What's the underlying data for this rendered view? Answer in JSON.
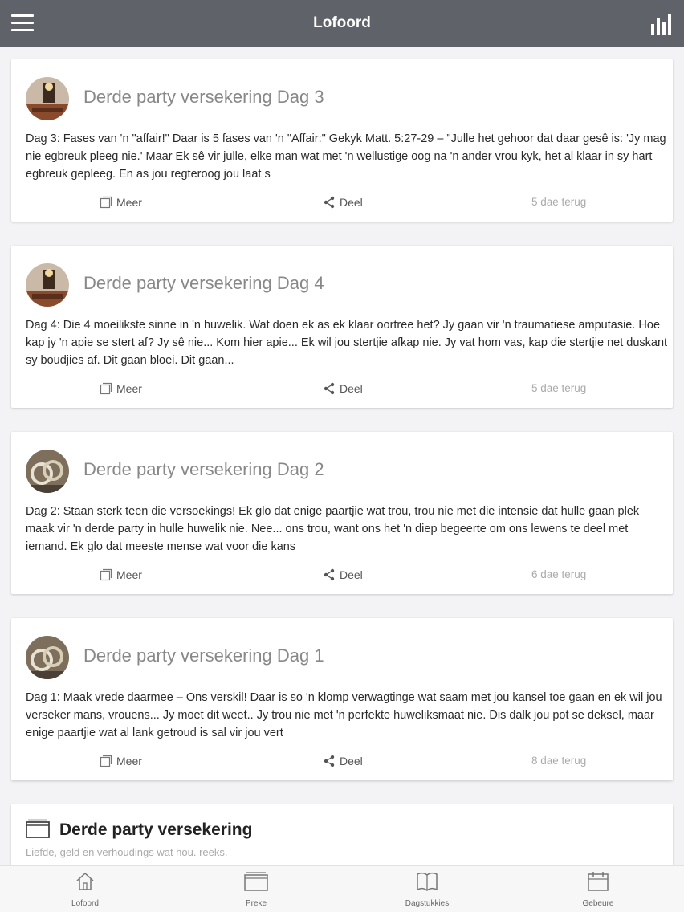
{
  "app": {
    "title": "Lofoord"
  },
  "header": {
    "menu_icon": "hamburger-menu-icon",
    "stats_icon": "bar-chart-icon"
  },
  "posts": [
    {
      "title": "Derde party versekering Dag 3",
      "text": "Dag 3: Fases van 'n \"affair!\" Daar is 5 fases van 'n \"Affair:\" Gekyk Matt. 5:27-29 – \"Julle het gehoor dat daar gesê is: 'Jy mag nie egbreuk pleeg nie.' Maar Ek sê vir julle, elke man wat met 'n wellustige oog na 'n ander vrou kyk, het al klaar in sy hart egbreuk gepleeg. En as jou regteroog jou laat s",
      "more_label": "Meer",
      "share_label": "Deel",
      "ago": "5 dae terug",
      "avatar": "lamp-photo"
    },
    {
      "title": "Derde party versekering Dag 4",
      "text": "Dag 4: Die 4 moeilikste sinne in 'n huwelik. Wat doen ek as ek klaar oortree het? Jy gaan vir 'n traumatiese amputasie. Hoe kap jy 'n apie se stert af? Jy sê nie... Kom hier apie... Ek wil jou stertjie afkap nie. Jy vat hom vas, kap die stertjie net duskant sy boudjies af. Dit gaan bloei. Dit gaan...",
      "more_label": "Meer",
      "share_label": "Deel",
      "ago": "5 dae terug",
      "avatar": "lamp-photo"
    },
    {
      "title": "Derde party versekering Dag 2",
      "text": "Dag 2: Staan sterk teen die versoekings! Ek glo dat enige paartjie wat trou, trou nie met die intensie dat hulle gaan plek maak vir 'n derde party in hulle huwelik nie. Nee... ons trou, want ons het 'n diep begeerte om ons lewens te deel met iemand. Ek glo dat meeste mense wat voor die kans",
      "more_label": "Meer",
      "share_label": "Deel",
      "ago": "6 dae terug",
      "avatar": "rings-photo"
    },
    {
      "title": "Derde party versekering Dag 1",
      "text": "Dag 1: Maak vrede daarmee – Ons verskil! Daar is so 'n klomp verwagtinge wat saam met jou kansel toe gaan en ek wil jou verseker mans, vrouens... Jy moet dit weet.. Jy trou nie met 'n perfekte huweliksmaat nie. Dis dalk jou pot se deksel, maar enige paartjie wat al lank getroud is sal vir jou vert",
      "more_label": "Meer",
      "share_label": "Deel",
      "ago": "8 dae terug",
      "avatar": "rings-photo"
    }
  ],
  "series": {
    "title": "Derde party versekering",
    "subtitle": "Liefde, geld en verhoudings wat hou. reeks."
  },
  "bottom_nav": [
    {
      "label": "Lofoord",
      "icon": "home-icon"
    },
    {
      "label": "Preke",
      "icon": "folder-icon"
    },
    {
      "label": "Dagstukkies",
      "icon": "book-icon"
    },
    {
      "label": "Gebeure",
      "icon": "calendar-icon"
    }
  ]
}
